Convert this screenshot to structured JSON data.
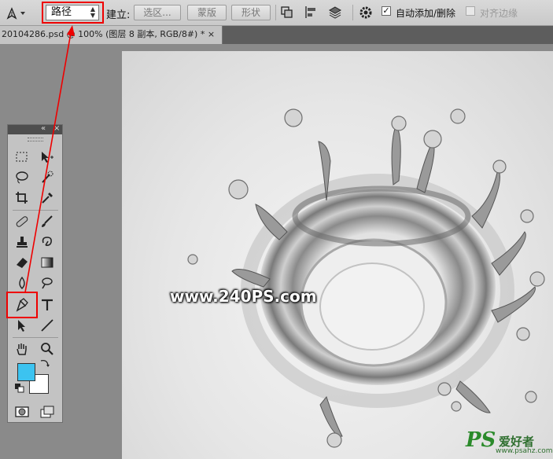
{
  "options_bar": {
    "tool_mode_value": "路径",
    "make_label": "建立:",
    "selection_button": "选区...",
    "mask_button": "蒙版",
    "shape_button": "形状",
    "auto_add_delete_label": "自动添加/删除",
    "auto_add_delete_checked": true,
    "align_edges_label": "对齐边缘",
    "align_edges_checked": false
  },
  "document_tab": {
    "title": "20104286.psd @ 100% (图层 8 副本, RGB/8#) *",
    "close_symbol": "×"
  },
  "tools_panel": {
    "collapse_symbol": "«",
    "close_symbol": "×",
    "foreground_color": "#3cc3f0",
    "background_color": "#ffffff",
    "active_tool": "pen-tool"
  },
  "watermarks": {
    "site_text": "www.240PS.com",
    "logo_ps": "PS",
    "logo_cn": "爱好者",
    "logo_url": "www.psahz.com"
  },
  "annotation_color": "#e00000"
}
